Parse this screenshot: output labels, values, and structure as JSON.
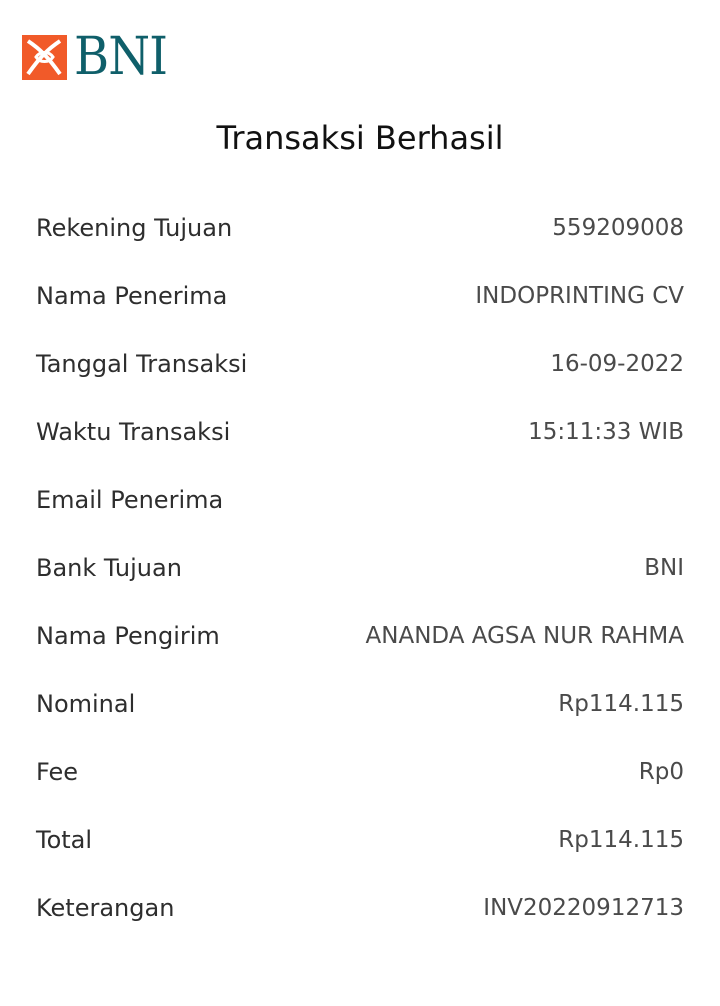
{
  "logo": {
    "text": "BNI",
    "icon": "bni-logo-mark",
    "accent": "#f15a29",
    "brand": "#0f5f6a"
  },
  "title": "Transaksi Berhasil",
  "details": [
    {
      "label": "Rekening Tujuan",
      "value": "559209008"
    },
    {
      "label": "Nama Penerima",
      "value": "INDOPRINTING CV"
    },
    {
      "label": "Tanggal Transaksi",
      "value": "16-09-2022"
    },
    {
      "label": "Waktu Transaksi",
      "value": "15:11:33 WIB"
    },
    {
      "label": "Email Penerima",
      "value": ""
    },
    {
      "label": "Bank Tujuan",
      "value": "BNI"
    },
    {
      "label": "Nama Pengirim",
      "value": "ANANDA AGSA NUR RAHMA"
    },
    {
      "label": "Nominal",
      "value": "Rp114.115"
    },
    {
      "label": "Fee",
      "value": "Rp0"
    },
    {
      "label": "Total",
      "value": "Rp114.115"
    },
    {
      "label": "Keterangan",
      "value": "INV20220912713"
    }
  ]
}
